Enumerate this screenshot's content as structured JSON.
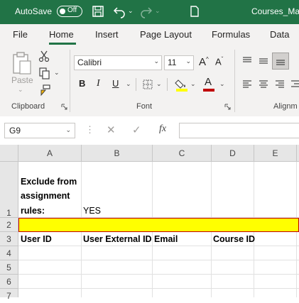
{
  "titlebar": {
    "autosave_label": "AutoSave",
    "autosave_state": "Off",
    "filename": "Courses_Mas"
  },
  "tabs": [
    "File",
    "Home",
    "Insert",
    "Page Layout",
    "Formulas",
    "Data"
  ],
  "ribbon": {
    "clipboard": {
      "paste_label": "Paste",
      "group_label": "Clipboard"
    },
    "font": {
      "font_name": "Calibri",
      "font_size": "11",
      "group_label": "Font",
      "bold": "B",
      "italic": "I",
      "underline": "U",
      "grow": "A",
      "shrink": "A",
      "font_color_letter": "A"
    },
    "alignment": {
      "group_label": "Alignm"
    }
  },
  "formula_bar": {
    "name_box": "G9",
    "fx": "fx",
    "value": ""
  },
  "columns": [
    "A",
    "B",
    "C",
    "D",
    "E"
  ],
  "rows": [
    "1",
    "2",
    "3",
    "4",
    "5",
    "6",
    "7"
  ],
  "cells": {
    "A1_line1": "Exclude from",
    "A1_line2": "assignment",
    "A1_line3": "rules:",
    "B1": "YES",
    "A3": "User ID",
    "B3": "User External ID",
    "C3": "Email",
    "D3": "Course ID"
  },
  "colors": {
    "excel_green": "#217346",
    "highlight_row": "#ffff00",
    "highlight_border": "#c00000"
  }
}
